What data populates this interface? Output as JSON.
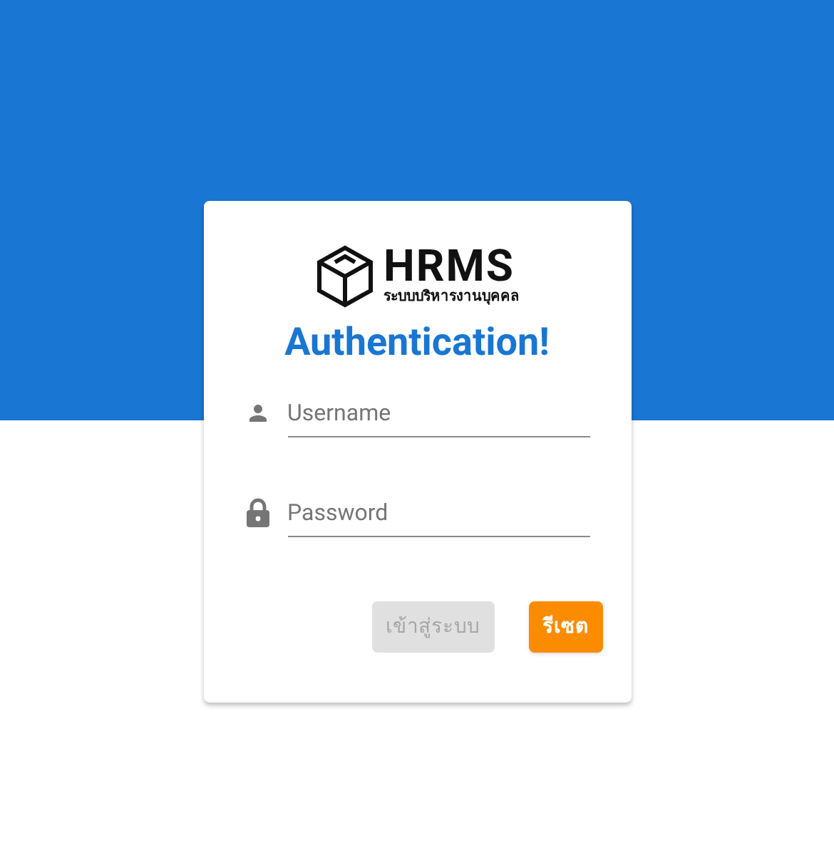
{
  "logo": {
    "wordmark": "HRMS",
    "tagline": "ระบบบริหารงานบุคคล"
  },
  "heading": "Authentication!",
  "fields": [
    {
      "kind": "user",
      "placeholder": "Username"
    },
    {
      "kind": "lock",
      "placeholder": "Password"
    }
  ],
  "buttons": [
    {
      "label": "เข้าสู่ระบบ",
      "kind": "login",
      "disabled": true
    },
    {
      "label": "รีเซต",
      "kind": "reset",
      "disabled": false
    }
  ]
}
